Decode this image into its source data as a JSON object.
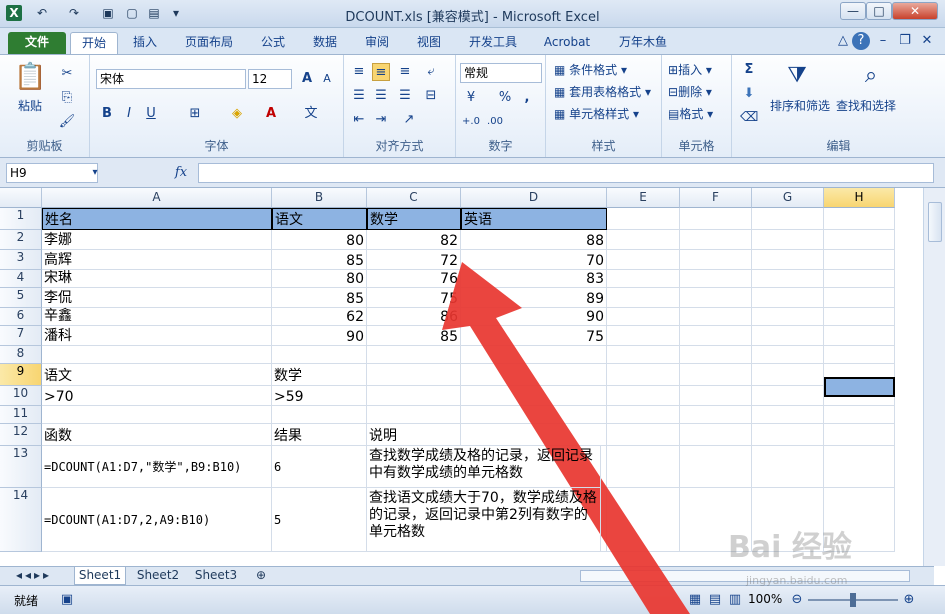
{
  "window": {
    "title": "DCOUNT.xls  [兼容模式] - Microsoft Excel",
    "minimize": "—",
    "maximize": "□",
    "close": "✕"
  },
  "tabs": [
    "文件",
    "开始",
    "插入",
    "页面布局",
    "公式",
    "数据",
    "审阅",
    "视图",
    "开发工具",
    "Acrobat",
    "万年木鱼"
  ],
  "ribbon": {
    "clipboard": {
      "label": "剪贴板",
      "paste": "粘贴"
    },
    "font": {
      "label": "字体",
      "name": "宋体",
      "size": "12",
      "bold": "B",
      "italic": "I",
      "underline": "U",
      "grow": "A",
      "shrink": "A"
    },
    "alignment": {
      "label": "对齐方式"
    },
    "number": {
      "label": "数字",
      "format": "常规",
      "percent": "%",
      "comma": ","
    },
    "styles": {
      "label": "样式",
      "conditional": "条件格式",
      "table": "套用表格格式",
      "cell": "单元格样式"
    },
    "cells": {
      "label": "单元格",
      "insert": "插入",
      "delete": "删除",
      "format": "格式"
    },
    "editing": {
      "label": "编辑",
      "sum": "Σ",
      "sort": "排序和筛选",
      "find": "查找和选择"
    }
  },
  "formula_bar": {
    "name_box": "H9",
    "fx": "fx",
    "formula": ""
  },
  "columns": [
    "A",
    "B",
    "C",
    "D",
    "E",
    "F",
    "G",
    "H"
  ],
  "rows": [
    "1",
    "2",
    "3",
    "4",
    "5",
    "6",
    "7",
    "8",
    "9",
    "10",
    "11",
    "12",
    "13",
    "14"
  ],
  "cells": {
    "A1": "姓名",
    "B1": "语文",
    "C1": "数学",
    "D1": "英语",
    "A2": "李娜",
    "B2": "80",
    "C2": "82",
    "D2": "88",
    "A3": "高辉",
    "B3": "85",
    "C3": "72",
    "D3": "70",
    "A4": "宋琳",
    "B4": "80",
    "C4": "76",
    "D4": "83",
    "A5": "李侃",
    "B5": "85",
    "C5": "75",
    "D5": "89",
    "A6": "辛鑫",
    "B6": "62",
    "C6": "86",
    "D6": "90",
    "A7": "潘科",
    "B7": "90",
    "C7": "85",
    "D7": "75",
    "A9": "语文",
    "B9": "数学",
    "A10": ">70",
    "B10": ">59",
    "A12": "函数",
    "B12": "结果",
    "C12": "说明",
    "A13": "=DCOUNT(A1:D7,\"数学\",B9:B10)",
    "B13": "6",
    "C13": "查找数学成绩及格的记录，返回记录中有数学成绩的单元格数",
    "A14": "=DCOUNT(A1:D7,2,A9:B10)",
    "B14": "5",
    "C14": "查找语文成绩大于70，数学成绩及格的记录，返回记录中第2列有数字的单元格数"
  },
  "sheets": [
    "Sheet1",
    "Sheet2",
    "Sheet3"
  ],
  "status": {
    "ready": "就绪",
    "zoom": "100%"
  },
  "watermark": {
    "brand": "Bai 经验",
    "url": "jingyan.baidu.com"
  },
  "colors": {
    "header_fill": "#8db3e2",
    "selected_fill": "#8db3e2",
    "arrow": "#e8352f",
    "file_tab": "#2f7d32"
  }
}
